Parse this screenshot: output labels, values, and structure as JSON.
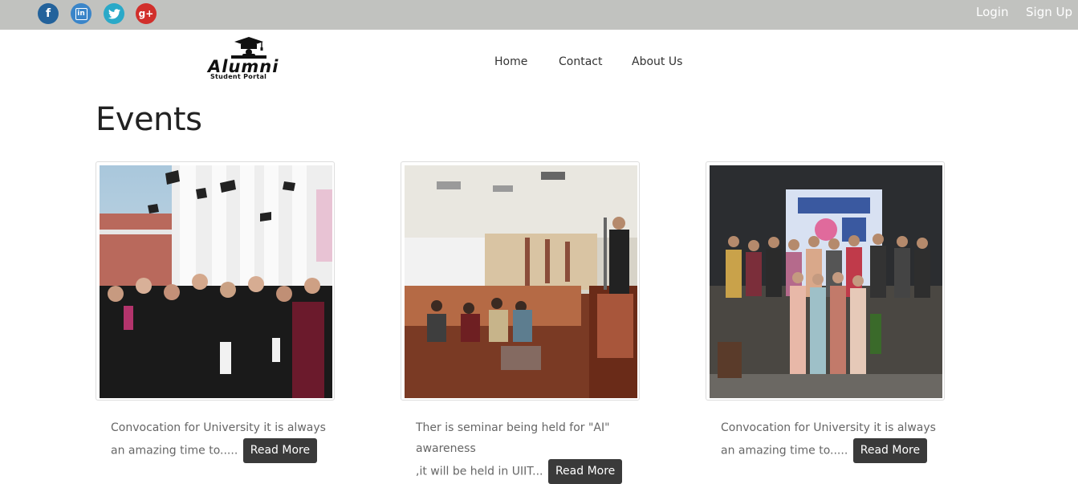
{
  "topbar": {
    "social": [
      {
        "icon": "facebook-icon",
        "glyph": "f"
      },
      {
        "icon": "linkedin-icon",
        "glyph": "in"
      },
      {
        "icon": "twitter-icon",
        "glyph": ""
      },
      {
        "icon": "google-plus-icon",
        "glyph": "g+"
      }
    ],
    "login_label": "Login",
    "signup_label": "Sign Up"
  },
  "logo": {
    "word": "Alumni",
    "subtitle": "Student Portal"
  },
  "nav": {
    "items": [
      "Home",
      "Contact",
      "About Us"
    ]
  },
  "main": {
    "title": "Events",
    "events": [
      {
        "line1": "Convocation for University it is always",
        "line2": "an amazing time to.....",
        "button": "Read More",
        "image": "graduation-photo"
      },
      {
        "line1": "Ther is seminar being held for \"AI\" awareness",
        "line2": ",it will be held in UIIT...",
        "button": "Read More",
        "image": "seminar-hall-photo"
      },
      {
        "line1": "Convocation for University it is always",
        "line2": "an amazing time to.....",
        "button": "Read More",
        "image": "group-photo"
      }
    ]
  },
  "colors": {
    "topbar": "#c1c2bf",
    "button": "#3a3a3a",
    "facebook": "#23629b",
    "linkedin": "#3a85c9",
    "twitter": "#2aa9c8",
    "googleplus": "#d12f2b"
  }
}
